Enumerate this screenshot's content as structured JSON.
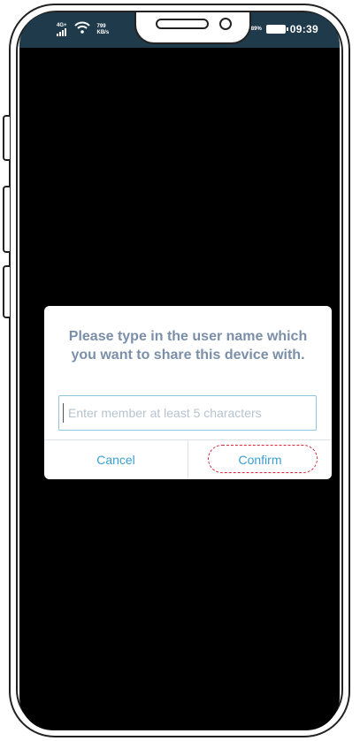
{
  "status_bar": {
    "network_type": "4G+",
    "net_speed_value": "799",
    "net_speed_unit": "KB/s",
    "battery_percent": "89%",
    "time": "09:39"
  },
  "dialog": {
    "message": "Please type in the user name which you want to share this device with.",
    "input_placeholder": "Enter member at least 5 characters",
    "input_value": "",
    "cancel_label": "Cancel",
    "confirm_label": "Confirm"
  },
  "colors": {
    "screen_background": "#000000",
    "status_bar": "#1f3a4a",
    "message_text": "#7b8fa8",
    "button_text": "#3a9fd0",
    "input_border": "#8fc6dd",
    "highlight": "#d8283a"
  },
  "icons": {
    "signal": "signal-icon",
    "wifi": "wifi-icon",
    "battery": "battery-icon"
  }
}
